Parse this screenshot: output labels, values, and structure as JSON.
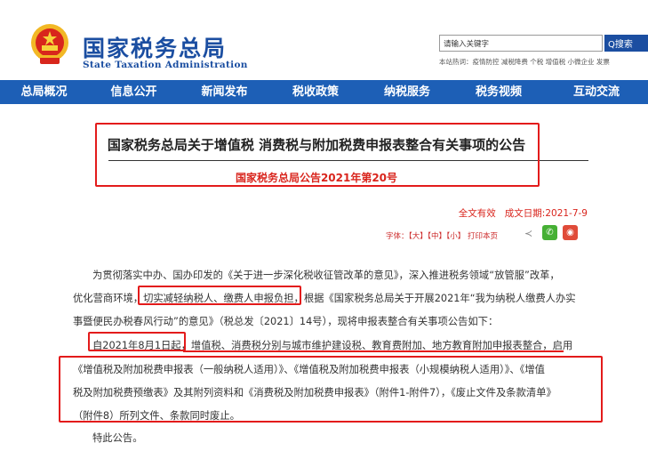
{
  "header": {
    "logo_cn": "国家税务总局",
    "logo_en": "State Taxation Administration",
    "search_placeholder": "请输入关键字",
    "search_button": "Q搜索",
    "hot_words": "本站热词：疫情防控 减税降费 个税 增值税 小微企业 发票"
  },
  "nav": {
    "items": [
      "总局概况",
      "信息公开",
      "新闻发布",
      "税收政策",
      "纳税服务",
      "税务视频",
      "互动交流"
    ]
  },
  "article": {
    "title": "国家税务总局关于增值税 消费税与附加税费申报表整合有关事项的公告",
    "doc_no": "国家税务总局公告2021年第20号",
    "validity": "全文有效",
    "date_label": "成文日期:",
    "date": "2021-7-9",
    "font_controls": "字体：【大】【中】【小】 打印本页",
    "share_symbol": "≺",
    "wechat_symbol": "✆",
    "weibo_symbol": "◉",
    "paragraphs": [
      "为贯彻落实中办、国办印发的《关于进一步深化税收征管改革的意见》，深入推进税务领域“放管服”改革，",
      "优化营商环境，切实减轻纳税人、缴费人申报负担，根据《国家税务总局关于开展2021年“我为纳税人缴费人办实",
      "事暨便民办税春风行动”的意见》（税总发〔2021〕14号），现将申报表整合有关事项公告如下：",
      "自2021年8月1日起，增值税、消费税分别与城市维护建设税、教育费附加、地方教育附加申报表整合，启用",
      "《增值税及附加税费申报表（一般纳税人适用）》、《增值税及附加税费申报表（小规模纳税人适用）》、《增值",
      "税及附加税费预缴表》及其附列资料和《消费税及附加税费申报表》（附件1-附件7），《废止文件及条款清单》",
      "（附件8）所列文件、条款同时废止。"
    ],
    "closing": "特此公告。"
  }
}
